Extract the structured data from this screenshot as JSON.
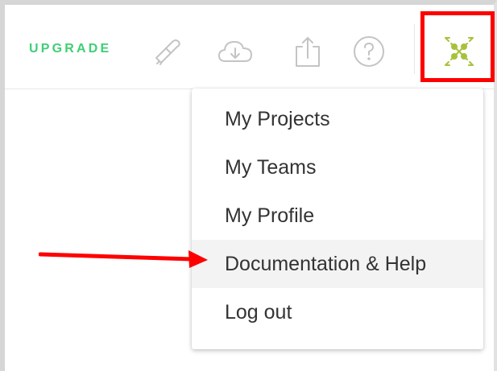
{
  "header": {
    "upgrade_label": "UPGRADE",
    "icons": [
      "paintbrush-icon",
      "cloud-download-icon",
      "share-upload-icon",
      "help-circle-icon"
    ],
    "avatar_icon": "project-avatar-icon"
  },
  "menu": {
    "items": [
      {
        "label": "My Projects"
      },
      {
        "label": "My Teams"
      },
      {
        "label": "My Profile"
      },
      {
        "label": "Documentation & Help"
      },
      {
        "label": "Log out"
      }
    ],
    "highlighted_index": 3
  },
  "colors": {
    "upgrade_green": "#3fcf75",
    "annotation_red": "#ff0000",
    "icon_gray": "#c4c4c4",
    "avatar_olive": "#a7c23a",
    "menu_text": "#333333"
  }
}
